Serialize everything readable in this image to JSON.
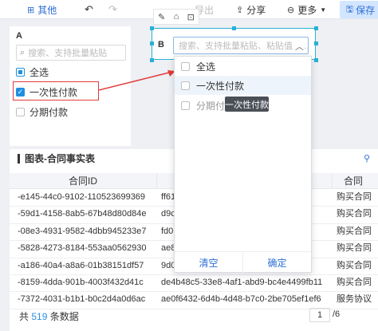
{
  "toolbar": {
    "other_label": "其他",
    "export_label": "导出",
    "share_label": "分享",
    "more_label": "更多",
    "save_label": "保存"
  },
  "filter_a": {
    "label": "A",
    "search_placeholder": "搜索、支持批量粘贴",
    "options": [
      {
        "label": "全选",
        "state": "partial"
      },
      {
        "label": "一次性付款",
        "state": "checked"
      },
      {
        "label": "分期付款",
        "state": "unchecked"
      }
    ]
  },
  "filter_b": {
    "label": "B",
    "placeholder": "搜索、支持批量粘贴、粘贴值通..."
  },
  "dropdown": {
    "options": [
      {
        "label": "全选"
      },
      {
        "label": "一次性付款"
      },
      {
        "label": "分期付款"
      }
    ],
    "tooltip": "一次性付款",
    "clear_label": "清空",
    "confirm_label": "确定"
  },
  "table": {
    "title": "图表-合同事实表",
    "headers": [
      "合同ID",
      "",
      "合同"
    ],
    "rows": [
      [
        "-e145-44c0-9102-110523699369",
        "ff61",
        "购买合同"
      ],
      [
        "-59d1-4158-8ab5-67b48d80d84e",
        "d9c",
        "购买合同"
      ],
      [
        "-08e3-4931-9582-4dbb945233e7",
        "fd0",
        "购买合同"
      ],
      [
        "-5828-4273-8184-553aa0562930",
        "ae8",
        "购买合同"
      ],
      [
        "-a186-40a4-a8a6-01b38151df57",
        "9d0",
        "购买合同"
      ],
      [
        "-8159-4dda-901b-4003f432d41c",
        "de4b48c5-33e8-4af1-abd9-bc4e4499fb11",
        "购买合同"
      ],
      [
        "-7372-4031-b1b1-b0c2d4a0d6ac",
        "ae0f6432-6d4b-4d48-b7c0-2be705ef1ef6",
        "服务协议"
      ]
    ],
    "footer_prefix": "共",
    "footer_count": "519",
    "footer_suffix": "条数据",
    "page_current": "1",
    "page_total": "/6"
  },
  "colors": {
    "accent": "#2f6fd6",
    "selection_border": "#2ab1d3",
    "annotation_red": "#e23b3b"
  }
}
